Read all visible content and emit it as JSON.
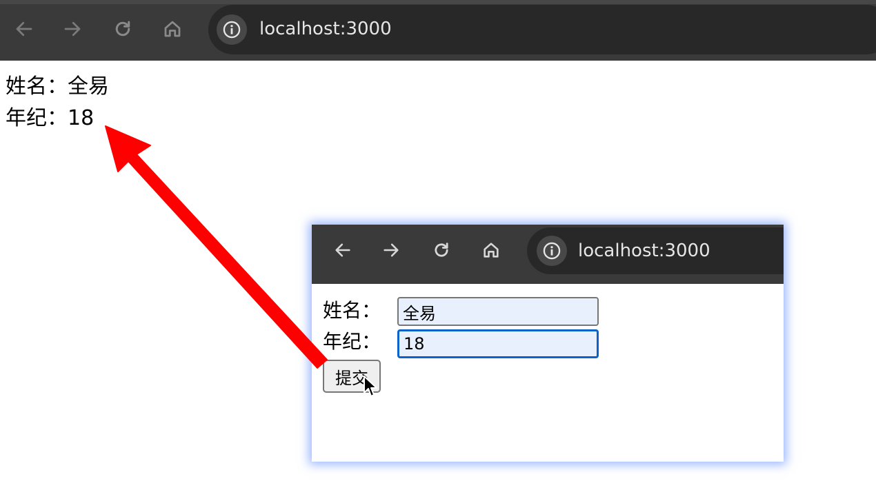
{
  "browser": {
    "url": "localhost:3000"
  },
  "result": {
    "name_line": "姓名：全易",
    "age_line": "年纪：18"
  },
  "inset": {
    "url": "localhost:3000",
    "form": {
      "name_label": "姓名：",
      "name_value": "全易",
      "age_label": "年纪：",
      "age_value": "18",
      "submit_label": "提交"
    }
  },
  "colors": {
    "toolbar": "#3a3a3a",
    "omnibox": "#282828",
    "annotation_arrow": "#ff0000",
    "focus_ring": "#0b63c9",
    "autofill_background": "#e8f0fe"
  },
  "icons": [
    "back-arrow-icon",
    "forward-arrow-icon",
    "reload-icon",
    "home-icon",
    "info-icon",
    "mouse-pointer-icon",
    "annotation-arrow"
  ]
}
